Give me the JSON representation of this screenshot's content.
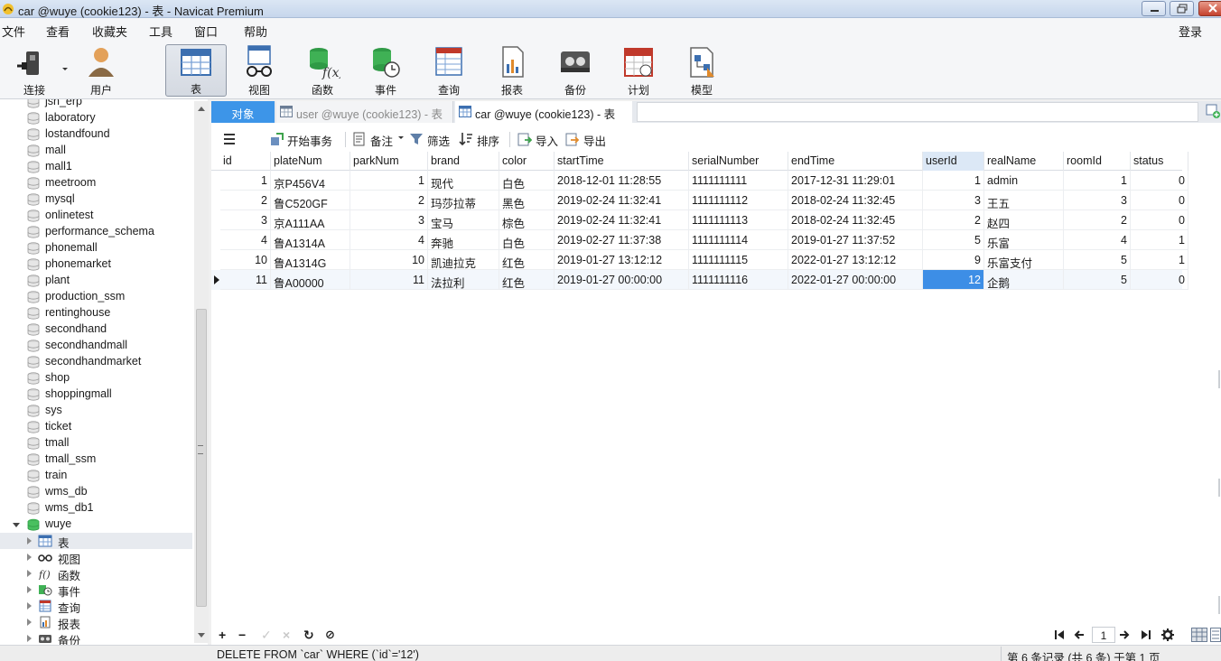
{
  "window": {
    "title": "car @wuye (cookie123) - 表 - Navicat Premium"
  },
  "menu": {
    "items": [
      "文件",
      "查看",
      "收藏夹",
      "工具",
      "窗口",
      "帮助"
    ],
    "login": "登录"
  },
  "toolbar": {
    "buttons": [
      {
        "label": "连接",
        "icon": "plug-icon"
      },
      {
        "label": "用户",
        "icon": "user-icon"
      },
      {
        "label": "表",
        "icon": "table-icon",
        "active": true
      },
      {
        "label": "视图",
        "icon": "glasses-icon"
      },
      {
        "label": "函数",
        "icon": "function-icon"
      },
      {
        "label": "事件",
        "icon": "event-clock-icon"
      },
      {
        "label": "查询",
        "icon": "query-icon"
      },
      {
        "label": "报表",
        "icon": "report-icon"
      },
      {
        "label": "备份",
        "icon": "backup-icon"
      },
      {
        "label": "计划",
        "icon": "calendar-icon"
      },
      {
        "label": "模型",
        "icon": "model-icon"
      }
    ]
  },
  "nav": {
    "databases": [
      "jsh_erp",
      "laboratory",
      "lostandfound",
      "mall",
      "mall1",
      "meetroom",
      "mysql",
      "onlinetest",
      "performance_schema",
      "phonemall",
      "phonemarket",
      "plant",
      "production_ssm",
      "rentinghouse",
      "secondhand",
      "secondhandmall",
      "secondhandmarket",
      "shop",
      "shoppingmall",
      "sys",
      "ticket",
      "tmall",
      "tmall_ssm",
      "train",
      "wms_db",
      "wms_db1"
    ],
    "open_db": "wuye",
    "children": [
      {
        "label": "表",
        "icon": "table-icon"
      },
      {
        "label": "视图",
        "icon": "glasses-icon"
      },
      {
        "label": "函数",
        "icon": "function-icon"
      },
      {
        "label": "事件",
        "icon": "event-clock-icon"
      },
      {
        "label": "查询",
        "icon": "query-icon"
      },
      {
        "label": "报表",
        "icon": "report-icon"
      },
      {
        "label": "备份",
        "icon": "backup-icon"
      }
    ]
  },
  "tabs": [
    {
      "label": "对象"
    },
    {
      "label": "user @wuye (cookie123) - 表"
    },
    {
      "label": "car @wuye (cookie123) - 表"
    }
  ],
  "subtoolbar": {
    "begin_tx": "开始事务",
    "memo": "备注",
    "filter": "筛选",
    "sort": "排序",
    "import": "导入",
    "export": "导出"
  },
  "grid": {
    "columns": [
      "id",
      "plateNum",
      "parkNum",
      "brand",
      "color",
      "startTime",
      "serialNumber",
      "endTime",
      "userId",
      "realName",
      "roomId",
      "status"
    ],
    "rows": [
      [
        "1",
        "京P456V4",
        "1",
        "现代",
        "白色",
        "2018-12-01 11:28:55",
        "1111111111",
        "2017-12-31 11:29:01",
        "1",
        "admin",
        "1",
        "0"
      ],
      [
        "2",
        "鲁C520GF",
        "2",
        "玛莎拉蒂",
        "黑色",
        "2019-02-24 11:32:41",
        "1111111112",
        "2018-02-24 11:32:45",
        "3",
        "王五",
        "3",
        "0"
      ],
      [
        "3",
        "京A111AA",
        "3",
        "宝马",
        "棕色",
        "2019-02-24 11:32:41",
        "1111111113",
        "2018-02-24 11:32:45",
        "2",
        "赵四",
        "2",
        "0"
      ],
      [
        "4",
        "鲁A1314A",
        "4",
        "奔驰",
        "白色",
        "2019-02-27 11:37:38",
        "1111111114",
        "2019-01-27 11:37:52",
        "5",
        "乐富",
        "4",
        "1"
      ],
      [
        "10",
        "鲁A1314G",
        "10",
        "凯迪拉克",
        "红色",
        "2019-01-27 13:12:12",
        "1111111115",
        "2022-01-27 13:12:12",
        "9",
        "乐富支付",
        "5",
        "1"
      ],
      [
        "11",
        "鲁A00000",
        "11",
        "法拉利",
        "红色",
        "2019-01-27 00:00:00",
        "1111111116",
        "2022-01-27 00:00:00",
        "12",
        "企鹅",
        "5",
        "0"
      ]
    ],
    "selected_row": 5,
    "selected_column": "userId"
  },
  "pager": {
    "page": "1"
  },
  "status": {
    "sql": "DELETE FROM `car` WHERE (`id`='12')",
    "records": "第 6 条记录 (共 6 条) 于第 1 页"
  },
  "colors": {
    "accent": "#3d95e8",
    "selection": "#3d8ee6"
  }
}
